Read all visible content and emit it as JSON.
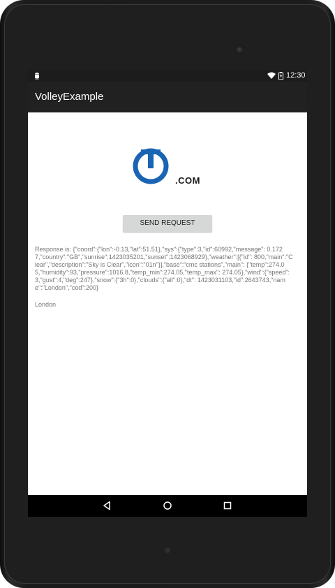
{
  "status_bar": {
    "time": "12:30",
    "icons": [
      "android-icon",
      "wifi-icon",
      "battery-icon"
    ]
  },
  "app_bar": {
    "title": "VolleyExample"
  },
  "logo": {
    "text": ".COM",
    "colors": {
      "ring": "#1a64b4",
      "text": "#1a1a1a"
    }
  },
  "send_button": {
    "label": "SEND REQUEST"
  },
  "response": {
    "text": "Response is: {\"coord\":{\"lon\":-0.13,\"lat\":51.51},\"sys\":{\"type\":3,\"id\":60992,\"message\": 0.1727,\"country\":\"GB\",\"sunrise\":1423035201,\"sunset\":1423068929},\"weather\":[{\"id\": 800,\"main\":\"Clear\",\"description\":\"Sky is Clear\",\"icon\":\"01n\"}],\"base\":\"cmc stations\",\"main\": {\"temp\":274.05,\"humidity\":93,\"pressure\":1016.8,\"temp_min\":274.05,\"temp_max\": 274.05},\"wind\":{\"speed\":3,\"gust\":4,\"deg\":247},\"snow\":{\"3h\":0},\"clouds\":{\"all\":0},\"dt\": 1423031103,\"id\":2643743,\"name\":\"London\",\"cod\":200}",
    "city": "London"
  },
  "nav_bar": {
    "icons": [
      "back-icon",
      "home-icon",
      "recents-icon"
    ]
  }
}
